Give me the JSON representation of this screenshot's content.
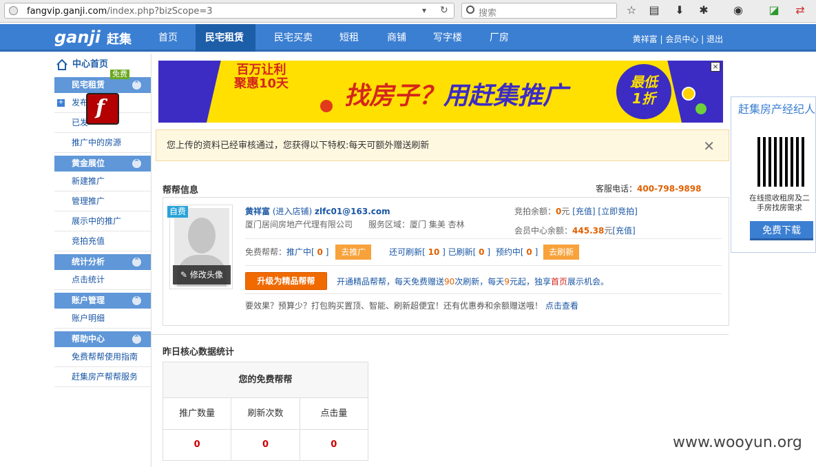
{
  "browser": {
    "url_host": "fangvip.ganji.com",
    "url_path": "/index.php?bizScope=3",
    "search_placeholder": "搜索"
  },
  "nav": {
    "logo": "ganji",
    "logo_cn": "赶集",
    "items": [
      "首页",
      "民宅租赁",
      "民宅买卖",
      "短租",
      "商铺",
      "写字楼",
      "厂房"
    ],
    "active_index": 1,
    "user_links": "黄祥富 | 会员中心 | 退出"
  },
  "sidebar": {
    "home": "中心首页",
    "free_tag": "免费",
    "sections": [
      {
        "title": "民宅租赁",
        "items": [
          "发布",
          "已发",
          "推广中的房源"
        ]
      },
      {
        "title": "黄金展位",
        "items": [
          "新建推广",
          "管理推广",
          "展示中的推广",
          "竞拍充值"
        ]
      },
      {
        "title": "统计分析",
        "items": [
          "点击统计"
        ]
      },
      {
        "title": "账户管理",
        "items": [
          "账户明细"
        ]
      },
      {
        "title": "帮助中心",
        "items": [
          "免费帮帮使用指南",
          "赶集房产帮帮服务"
        ]
      }
    ]
  },
  "banner": {
    "tag_line1": "百万让利",
    "tag_line2": "聚惠10天",
    "main_red": "找房子？",
    "main_blue": "用赶集推广",
    "circle_line1": "最低",
    "circle_line2": "1折",
    "close": "×"
  },
  "notice": {
    "text": "您上传的资料已经审核通过，您获得以下特权:每天可额外赠送刷新",
    "close": "✕"
  },
  "help_info": {
    "title": "帮帮信息",
    "service_label": "客服电话：",
    "service_phone": "400-798-9898",
    "self_tag": "自费",
    "edit_avatar": "修改头像",
    "name": "黄祥富",
    "enter_shop": "(进入店铺)",
    "email": "zlfc01@163.com",
    "company": "厦门居间房地产代理有限公司",
    "area": "服务区域：厦门 集美 杏林",
    "bid_balance_label": "竞拍余额：",
    "bid_balance": "0",
    "bid_unit": "元",
    "recharge": "[充值]",
    "bid_now": "[立即竞拍]",
    "member_balance_label": "会员中心余额：",
    "member_balance": "445.38",
    "member_unit": "元",
    "member_recharge": "[充值]",
    "free_label": "免费帮帮：",
    "promoting_label": "推广中[",
    "promoting": "0",
    "bracket_close": "]",
    "go_promote": "去推广",
    "can_refresh_label": "还可刷新[",
    "can_refresh": "10",
    "refreshed_label": "已刷新[",
    "refreshed": "0",
    "booked_label": "预约中[",
    "booked": "0",
    "go_refresh": "去刷新",
    "upgrade_btn": "升级为精品帮帮",
    "upgrade_text_a": "开通精品帮帮，每天免费赠送",
    "upgrade_num1": "90",
    "upgrade_text_b": "次刷新，每天",
    "upgrade_num2": "9",
    "upgrade_text_c": "元起，独享",
    "upgrade_home": "首页",
    "upgrade_text_d": "展示机会。",
    "effect_text": "要效果？预算少？打包购买置顶、智能、刷新超便宜！还有优惠券和余额赠送哦！",
    "check_link": "点击查看"
  },
  "stats": {
    "title": "昨日核心数据统计",
    "table_head": "您的免费帮帮",
    "columns": [
      "推广数量",
      "刷新次数",
      "点击量"
    ],
    "values": [
      "0",
      "0",
      "0"
    ]
  },
  "right_panel": {
    "title": "赶集房产经纪人",
    "text": "在线揽收租房及二手房找房需求",
    "button": "免费下载"
  },
  "watermark": "www.wooyun.org"
}
